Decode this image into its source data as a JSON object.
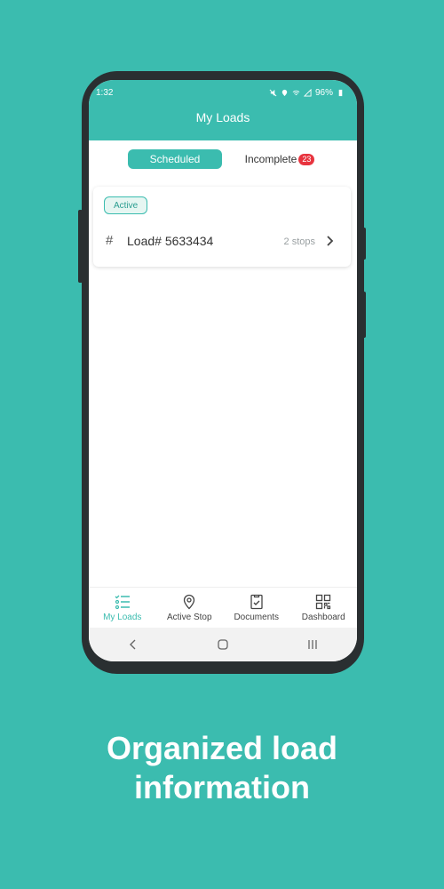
{
  "status_bar": {
    "time": "1:32",
    "battery": "96%"
  },
  "header": {
    "title": "My Loads"
  },
  "tabs": {
    "scheduled_label": "Scheduled",
    "incomplete_label": "Incomplete",
    "incomplete_count": "23"
  },
  "loads": [
    {
      "status": "Active",
      "load_label": "Load# 5633434",
      "stops": "2 stops"
    }
  ],
  "bottom_nav": [
    {
      "label": "My Loads",
      "icon": "checklist-icon",
      "active": true
    },
    {
      "label": "Active Stop",
      "icon": "location-pin-icon",
      "active": false
    },
    {
      "label": "Documents",
      "icon": "document-check-icon",
      "active": false
    },
    {
      "label": "Dashboard",
      "icon": "grid-icon",
      "active": false
    }
  ],
  "caption": {
    "line1": "Organized load",
    "line2": "information"
  },
  "colors": {
    "brand": "#3bbcaf",
    "badge": "#e8343f",
    "background": "#3bbcaf"
  }
}
